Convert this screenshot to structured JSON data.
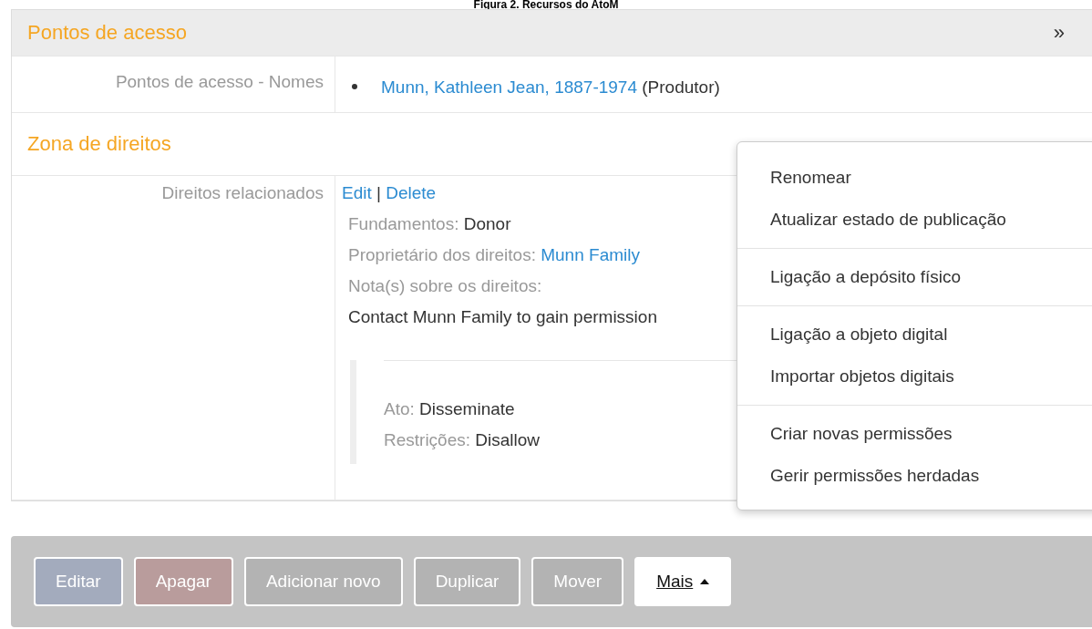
{
  "caption": "Figura 2. Recursos do AtoM",
  "sections": [
    {
      "title": "Pontos de acesso",
      "shaded": true,
      "collapse_icon": "»",
      "rows": [
        {
          "kind": "names",
          "label": "Pontos de acesso - Nomes",
          "items": [
            {
              "link": "Munn, Kathleen Jean, 1887-1974",
              "note": "(Produtor)"
            }
          ]
        }
      ]
    },
    {
      "title": "Zona de direitos",
      "shaded": false,
      "rows": [
        {
          "kind": "rights",
          "label": "Direitos relacionados",
          "actions": [
            "Edit",
            "Delete"
          ],
          "separator": "|",
          "fields": [
            {
              "label": "Fundamentos:",
              "value": "Donor",
              "kind": "text"
            },
            {
              "label": "Proprietário dos direitos:",
              "value": "Munn Family",
              "kind": "link"
            },
            {
              "label": "Nota(s) sobre os direitos:"
            }
          ],
          "note": "Contact Munn Family to gain permission",
          "granted": [
            {
              "label": "Ato:",
              "value": "Disseminate"
            },
            {
              "label": "Restrições:",
              "value": "Disallow"
            }
          ]
        }
      ]
    }
  ],
  "actions": [
    {
      "label": "Editar",
      "kind": "primary"
    },
    {
      "label": "Apagar",
      "kind": "danger"
    },
    {
      "label": "Adicionar novo",
      "kind": "default"
    },
    {
      "label": "Duplicar",
      "kind": "default"
    },
    {
      "label": "Mover",
      "kind": "default"
    },
    {
      "label": "Mais",
      "kind": "dropdown",
      "expanded": true
    }
  ],
  "menu": [
    [
      "Renomear",
      "Atualizar estado de publicação"
    ],
    [
      "Ligação a depósito físico"
    ],
    [
      "Ligação a objeto digital",
      "Importar objetos digitais"
    ],
    [
      "Criar novas permissões",
      "Gerir permissões herdadas"
    ]
  ]
}
